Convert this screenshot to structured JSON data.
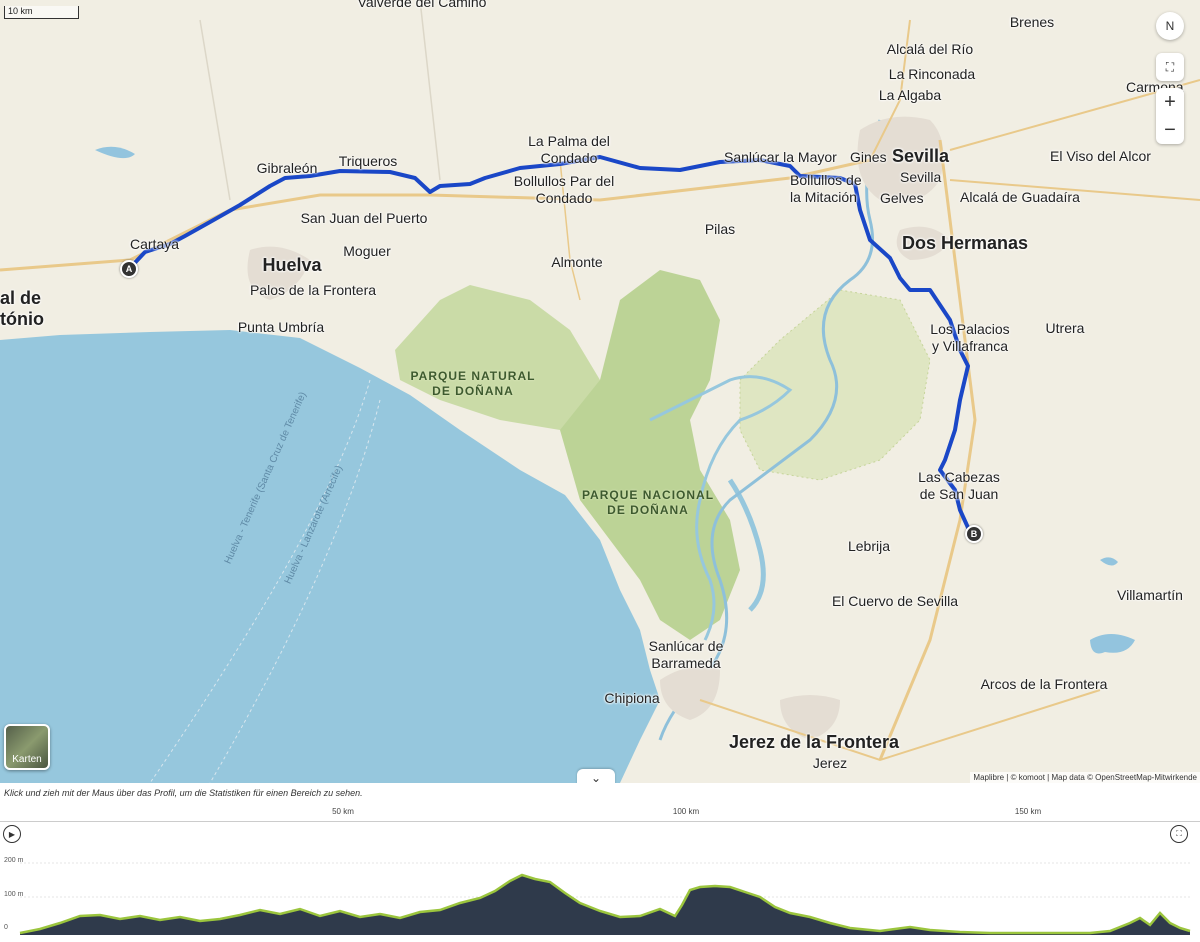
{
  "map": {
    "scale_label": "10 km",
    "compass_label": "N",
    "zoom_in": "+",
    "zoom_out": "−",
    "fullscreen_icon": "⛶",
    "layers_button_label": "Karten",
    "attribution": "Maplibre | © komoot | Map data © OpenStreetMap-Mitwirkende",
    "collapse_icon": "⌄",
    "route_color": "#1a47c7",
    "start_marker": "A",
    "end_marker": "B",
    "places": [
      {
        "id": "valverde",
        "text": "Valverde del Camino"
      },
      {
        "id": "brenes",
        "text": "Brenes"
      },
      {
        "id": "alcala-rio",
        "text": "Alcalá del Río"
      },
      {
        "id": "rinconada",
        "text": "La Rinconada"
      },
      {
        "id": "algaba",
        "text": "La Algaba"
      },
      {
        "id": "carmona",
        "text": "Carmona"
      },
      {
        "id": "gibraleon",
        "text": "Gibraleón"
      },
      {
        "id": "trigueros",
        "text": "Triqueros"
      },
      {
        "id": "palma",
        "text": "La Palma del Condado"
      },
      {
        "id": "sanlucar-mayor",
        "text": "Sanlúcar la Mayor"
      },
      {
        "id": "gines",
        "text": "Gines"
      },
      {
        "id": "sevilla-big",
        "text": "Sevilla"
      },
      {
        "id": "sevilla",
        "text": "Sevilla"
      },
      {
        "id": "viso",
        "text": "El Viso del Alcor"
      },
      {
        "id": "bollullos",
        "text": "Bollullos Par del Condado"
      },
      {
        "id": "bollullos-mit",
        "text": "Bollullos de la Mitación"
      },
      {
        "id": "gelves",
        "text": "Gelves"
      },
      {
        "id": "alcala-guadaira",
        "text": "Alcalá de Guadaíra"
      },
      {
        "id": "san-juan",
        "text": "San Juan del Puerto"
      },
      {
        "id": "cartaya",
        "text": "Cartaya"
      },
      {
        "id": "moguer",
        "text": "Moguer"
      },
      {
        "id": "huelva",
        "text": "Huelva"
      },
      {
        "id": "pilas",
        "text": "Pilas"
      },
      {
        "id": "dos-hermanas",
        "text": "Dos Hermanas"
      },
      {
        "id": "almonte",
        "text": "Almonte"
      },
      {
        "id": "palos",
        "text": "Palos de la Frontera"
      },
      {
        "id": "punta-umbria",
        "text": "Punta Umbría"
      },
      {
        "id": "vila-real",
        "text": "al de\ntónio"
      },
      {
        "id": "palacios",
        "text": "Los Palacios\ny Villafranca"
      },
      {
        "id": "utrera",
        "text": "Utrera"
      },
      {
        "id": "cabezas",
        "text": "Las Cabezas\nde San Juan"
      },
      {
        "id": "lebrija",
        "text": "Lebrija"
      },
      {
        "id": "cuervo",
        "text": "El Cuervo de Sevilla"
      },
      {
        "id": "villamartin",
        "text": "Villamartín"
      },
      {
        "id": "sanlucar-barr",
        "text": "Sanlúcar de\nBarrameda"
      },
      {
        "id": "chipiona",
        "text": "Chipiona"
      },
      {
        "id": "arcos",
        "text": "Arcos de la Frontera"
      },
      {
        "id": "jerez-big",
        "text": "Jerez de la Frontera"
      },
      {
        "id": "jerez",
        "text": "Jerez"
      }
    ],
    "parks": [
      {
        "id": "pn-donana",
        "text": "PARQUE NATURAL\nDE DOÑANA"
      },
      {
        "id": "pnac-donana",
        "text": "PARQUE NACIONAL\nDE DOÑANA"
      }
    ],
    "ferry_lines": [
      {
        "id": "ferry1",
        "text": "Huelva - Tenerife (Santa Cruz de Tenerife)"
      },
      {
        "id": "ferry2",
        "text": "Huelva - Lanzarote (Arrecife)"
      }
    ]
  },
  "profile": {
    "hint": "Klick und zieh mit der Maus über das Profil, um die Statistiken für einen Bereich zu sehen.",
    "km_ticks": [
      "50 km",
      "100 km",
      "150 km"
    ],
    "y_ticks": [
      "200 m",
      "100 m",
      "0"
    ],
    "play_icon": "▶",
    "expand_icon": "⛶",
    "fill_color": "#2f3a4b",
    "line_color": "#9bc53d"
  }
}
